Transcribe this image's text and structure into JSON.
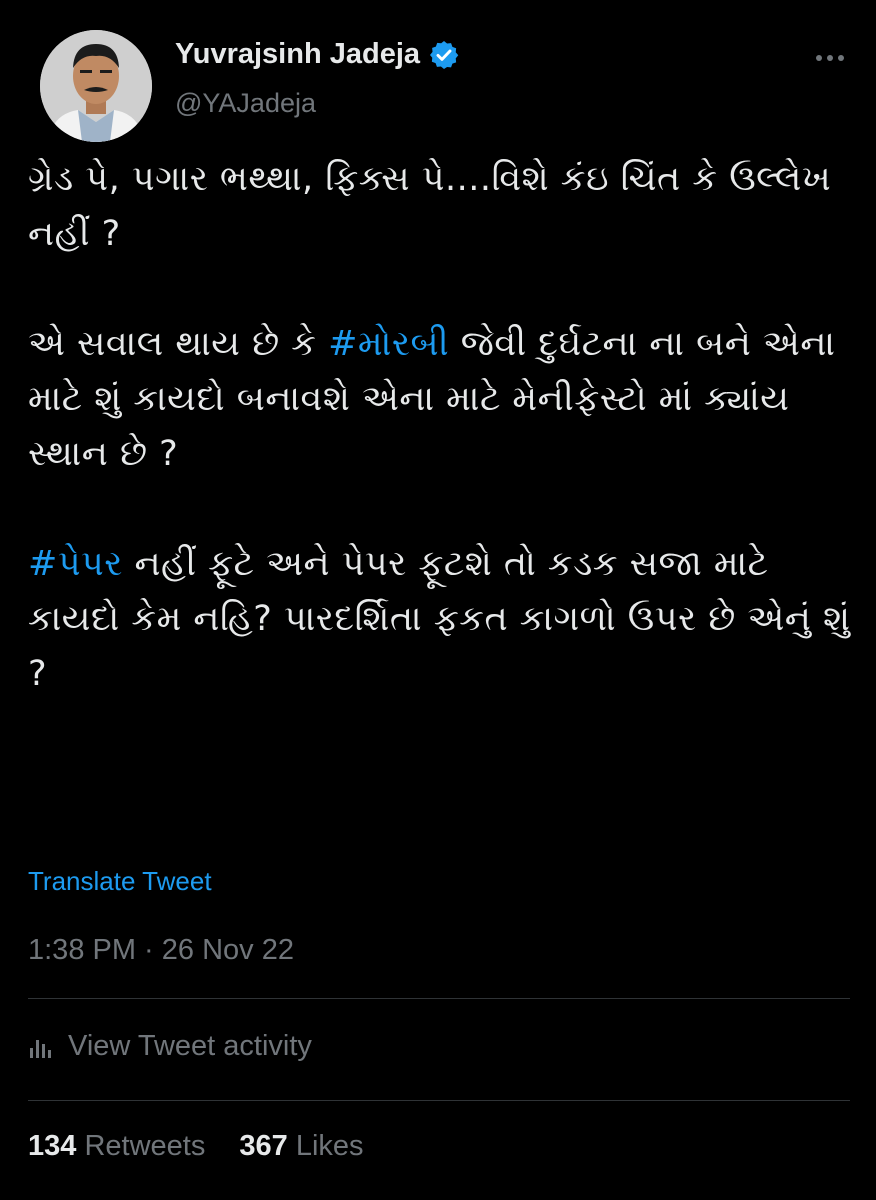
{
  "author": {
    "display_name": "Yuvrajsinh Jadeja",
    "handle": "@YAJadeja",
    "verified_icon": "verified-badge-icon",
    "avatar": "profile-photo"
  },
  "tweet": {
    "paragraph1": "ગ્રેડ પે, પગાર ભથ્થા, ફિક્સ પે....વિશે કંઇ ચિંત કે ઉલ્લેખ નહીં ?",
    "paragraph2_before": "એ સવાલ થાય છે કે ",
    "hashtag1": "#મોરબી",
    "paragraph2_after": " જેવી દુર્ઘટના ના બને એના માટે શું કાયદો બનાવશે એના માટે મેનીફેસ્ટો માં ક્યાંય સ્થાન છે ?",
    "hashtag2": "#પેપર",
    "paragraph3_after": " નહીં ફૂટે અને પેપર ફૂટશે તો કડક સજા માટે કાયદો કેમ નહિ? પારદર્શિતા ફકત કાગળો ઉપર છે એનું શું ?",
    "translate_label": "Translate Tweet",
    "timestamp": "1:38 PM · 26 Nov 22"
  },
  "activity": {
    "label": "View Tweet activity",
    "icon": "bar-chart-icon"
  },
  "stats": {
    "retweets_count": "134",
    "retweets_label": "Retweets",
    "likes_count": "367",
    "likes_label": "Likes"
  },
  "colors": {
    "background": "#000000",
    "text": "#e7e9ea",
    "muted": "#71767b",
    "accent": "#1d9bf0"
  }
}
